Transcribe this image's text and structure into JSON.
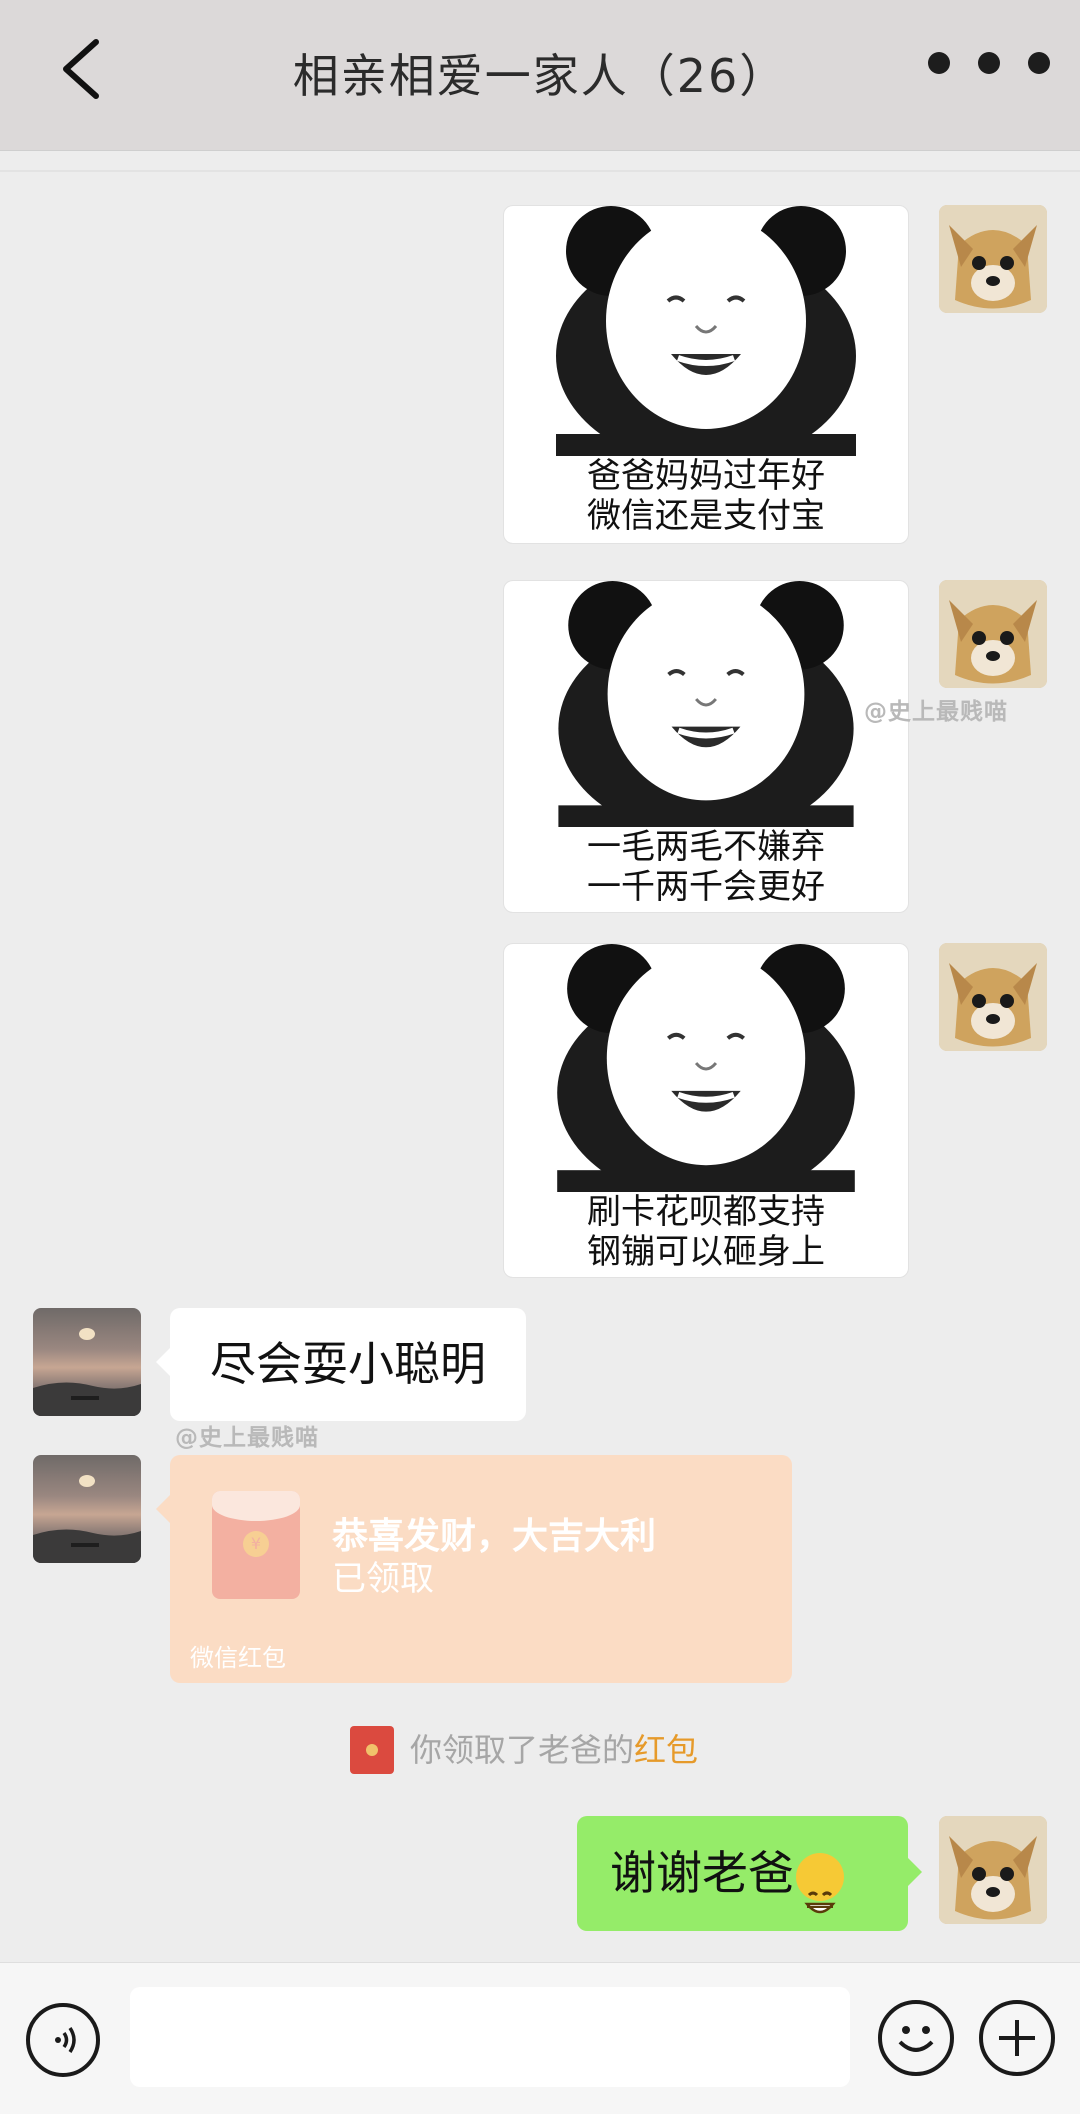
{
  "header": {
    "title": "相亲相爱一家人（26）",
    "back_icon": "chevron-left-icon",
    "more_icon": "more-dots-icon"
  },
  "watermark": "@史上最贱喵",
  "messages": {
    "stickers": [
      {
        "caption": "爸爸妈妈过年好\n微信还是支付宝"
      },
      {
        "caption": "一毛两毛不嫌弃\n一千两千会更好"
      },
      {
        "caption": "刷卡花呗都支持\n钢镚可以砸身上"
      }
    ],
    "reply_text": "尽会耍小聪明",
    "red_packet": {
      "title": "恭喜发财，大吉大利",
      "status": "已领取",
      "footer": "微信红包"
    },
    "notice": {
      "text": "你领取了老爸的",
      "link": "红包"
    },
    "thanks_text": "谢谢老爸"
  },
  "input_bar": {
    "voice_icon": "voice-icon",
    "emoji_icon": "emoji-icon",
    "plus_icon": "plus-icon"
  },
  "colors": {
    "header_bg": "#dcd9d9",
    "chat_bg": "#ededed",
    "green_bubble": "#95ec69",
    "red_packet_bg": "#fbdcc4",
    "notice_link": "#e69a2a"
  }
}
